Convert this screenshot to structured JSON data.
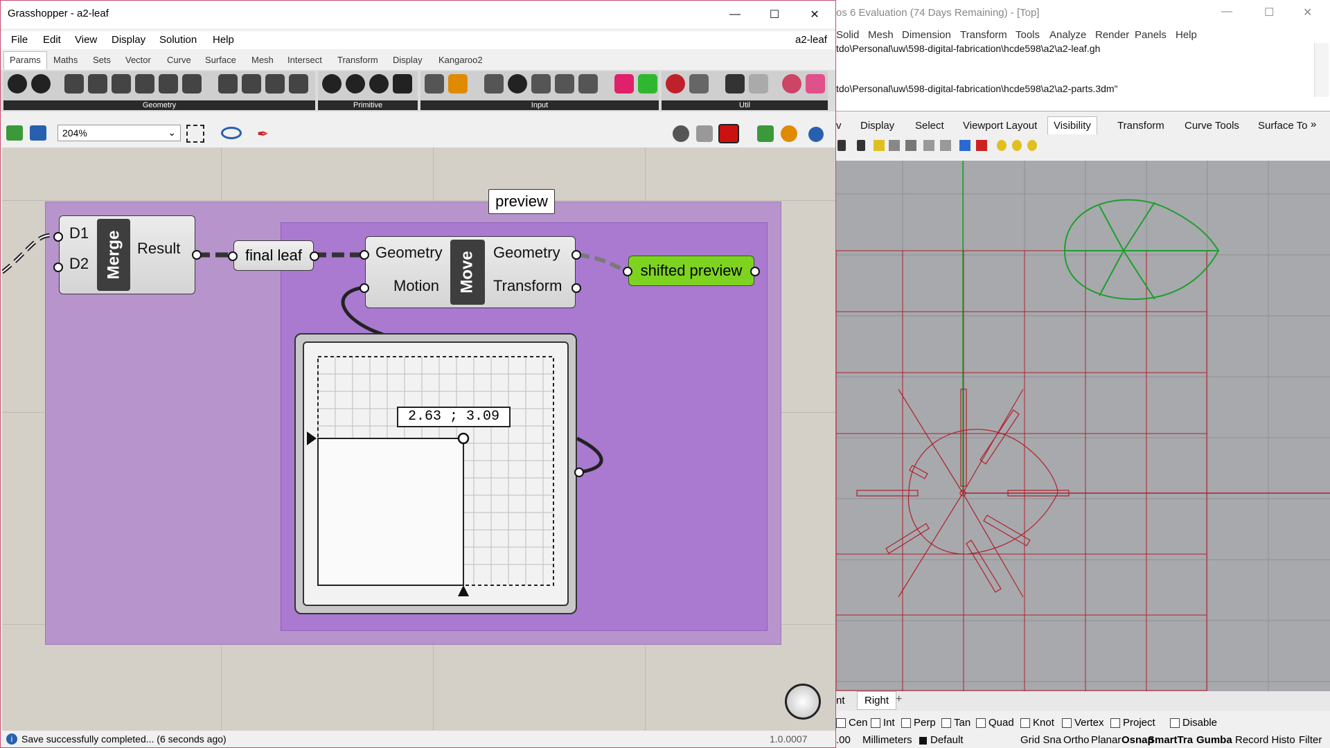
{
  "grasshopper": {
    "title": "Grasshopper - a2-leaf",
    "doc_name": "a2-leaf",
    "menu": [
      "File",
      "Edit",
      "View",
      "Display",
      "Solution",
      "Help"
    ],
    "tabs": [
      "Params",
      "Maths",
      "Sets",
      "Vector",
      "Curve",
      "Surface",
      "Mesh",
      "Intersect",
      "Transform",
      "Display",
      "Kangaroo2"
    ],
    "active_tab": "Params",
    "ribbon_groups": [
      "Geometry",
      "Primitive",
      "Input",
      "Util"
    ],
    "zoom": "204%",
    "canvas": {
      "group_label": "preview",
      "merge": {
        "nickname": "Merge",
        "inputs": [
          "D1",
          "D2"
        ],
        "output": "Result"
      },
      "final_leaf": "final leaf",
      "move": {
        "nickname": "Move",
        "inputs": [
          "Geometry",
          "Motion"
        ],
        "outputs": [
          "Geometry",
          "Transform"
        ]
      },
      "shifted_preview": "shifted preview",
      "md_slider_value": "2.63 ; 3.09"
    },
    "status": "Save successfully completed... (6 seconds ago)",
    "version": "1.0.0007"
  },
  "rhino": {
    "title": "os 6 Evaluation (74 Days Remaining) - [Top]",
    "menu": [
      "Solid",
      "Mesh",
      "Dimension",
      "Transform",
      "Tools",
      "Analyze",
      "Render",
      "Panels",
      "Help"
    ],
    "cmd_lines": [
      "tdo\\Personal\\uw\\598-digital-fabrication\\hcde598\\a2\\a2-leaf.gh",
      "tdo\\Personal\\uw\\598-digital-fabrication\\hcde598\\a2\\a2-parts.3dm\""
    ],
    "tabs": [
      "v",
      "Display",
      "Select",
      "Viewport Layout",
      "Visibility",
      "Transform",
      "Curve Tools",
      "Surface To"
    ],
    "active_tab": "Visibility",
    "viewport_tabs": [
      "nt",
      "Right"
    ],
    "osnaps": [
      "Cen",
      "Int",
      "Perp",
      "Tan",
      "Quad",
      "Knot",
      "Vertex",
      "Project",
      "Disable"
    ],
    "status": {
      "tol": ".00",
      "units": "Millimeters",
      "layer": "Default",
      "items": [
        "Grid Sna",
        "Ortho",
        "Planar",
        "Osnap",
        "SmartTra",
        "Gumba",
        "Record Histo",
        "Filter"
      ]
    }
  },
  "colors": {
    "group_outer": "#b794cc",
    "group_inner": "#a97ad0",
    "shifted_preview": "#7ed321",
    "rhino_red": "#b0202a",
    "rhino_green": "#1e9e2e"
  }
}
